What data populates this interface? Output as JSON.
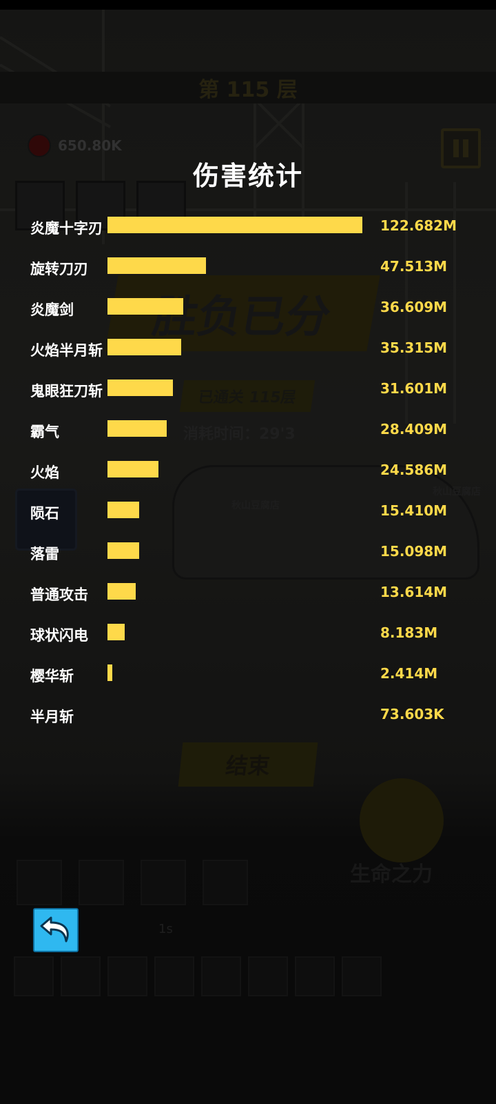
{
  "background": {
    "floor_title": "第 115 层",
    "currency_value": "650.80K",
    "result_text": "胜负已分",
    "cleared_text": "已通关 115层",
    "elapsed_time": "消耗时间：29'3",
    "car_sign_1": "秋山豆腐店",
    "car_sign_2": "秋山豆腐店",
    "finish_label": "结束",
    "life_label": "生命之力",
    "cooldown": "1s"
  },
  "stats": {
    "title": "伤害统计",
    "colors": {
      "bar": "#fed94a",
      "value": "#fed94a"
    },
    "rows": [
      {
        "name": "炎魔十字刃",
        "value": "122.682M",
        "damage": 122.682
      },
      {
        "name": "旋转刀刃",
        "value": "47.513M",
        "damage": 47.513
      },
      {
        "name": "炎魔剑",
        "value": "36.609M",
        "damage": 36.609
      },
      {
        "name": "火焰半月斩",
        "value": "35.315M",
        "damage": 35.315
      },
      {
        "name": "鬼眼狂刀斩",
        "value": "31.601M",
        "damage": 31.601
      },
      {
        "name": "霸气",
        "value": "28.409M",
        "damage": 28.409
      },
      {
        "name": "火焰",
        "value": "24.586M",
        "damage": 24.586
      },
      {
        "name": "陨石",
        "value": "15.410M",
        "damage": 15.41
      },
      {
        "name": "落雷",
        "value": "15.098M",
        "damage": 15.098
      },
      {
        "name": "普通攻击",
        "value": "13.614M",
        "damage": 13.614
      },
      {
        "name": "球状闪电",
        "value": "8.183M",
        "damage": 8.183
      },
      {
        "name": "樱华斩",
        "value": "2.414M",
        "damage": 2.414
      },
      {
        "name": "半月斩",
        "value": "73.603K",
        "damage": 0.073603
      }
    ]
  },
  "back_button": {
    "icon": "undo-arrow-icon"
  }
}
